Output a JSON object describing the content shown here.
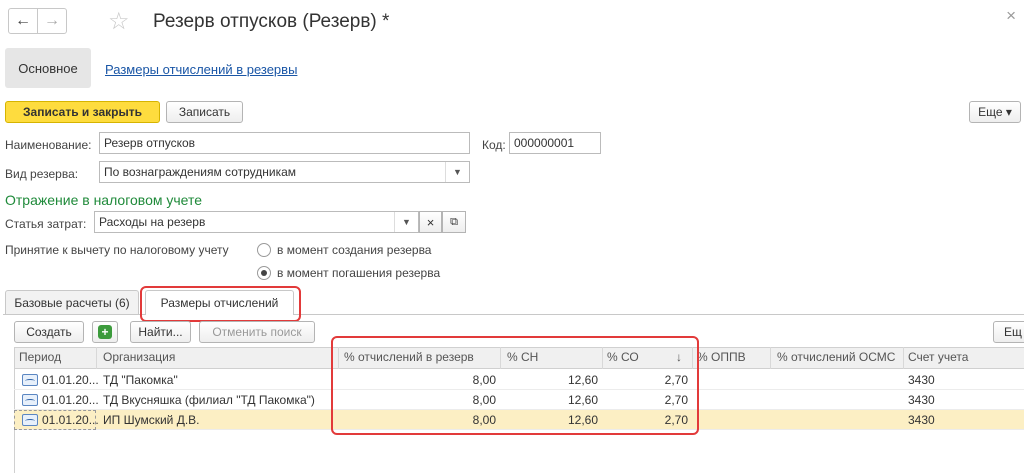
{
  "header": {
    "title": "Резерв отпусков (Резерв) *",
    "back_glyph": "←",
    "forward_glyph": "→",
    "star_glyph": "☆",
    "close_glyph": "×"
  },
  "sections": {
    "main": "Основное",
    "link": "Размеры отчислений в резервы"
  },
  "toolbar": {
    "save_close": "Записать и закрыть",
    "save": "Записать",
    "more": "Еще ▾"
  },
  "form": {
    "name_label": "Наименование:",
    "name_value": "Резерв отпусков",
    "code_label": "Код:",
    "code_value": "000000001",
    "reserve_type_label": "Вид резерва:",
    "reserve_type_value": "По вознаграждениям сотрудникам",
    "tax_section": "Отражение в налоговом учете",
    "expense_label": "Статья затрат:",
    "expense_value": "Расходы на резерв",
    "deduction_label": "Принятие к вычету по налоговому учету",
    "radio_option_1": "в момент создания резерва",
    "radio_option_2": "в момент погашения резерва",
    "selected_option": 2
  },
  "tabs": [
    {
      "label": "Базовые расчеты (6)",
      "active": false
    },
    {
      "label": "Размеры отчислений",
      "active": true
    }
  ],
  "table_toolbar": {
    "create": "Создать",
    "find": "Найти...",
    "cancel_search": "Отменить поиск",
    "more": "Ещ"
  },
  "table": {
    "columns": [
      "Период",
      "Организация",
      "% отчислений в резерв",
      "% СН",
      "% СО",
      "% ОППВ",
      "% отчислений ОСМС",
      "Счет учета"
    ],
    "sort_glyph": "↓",
    "rows": [
      {
        "period": "01.01.20...",
        "org": "ТД \"Пакомка\"",
        "pct_reserve": "8,00",
        "pct_sn": "12,60",
        "pct_so": "2,70",
        "pct_oppv": "",
        "pct_osms": "",
        "account": "3430",
        "selected": false
      },
      {
        "period": "01.01.20...",
        "org": "ТД Вкусняшка (филиал \"ТД Пакомка\")",
        "pct_reserve": "8,00",
        "pct_sn": "12,60",
        "pct_so": "2,70",
        "pct_oppv": "",
        "pct_osms": "",
        "account": "3430",
        "selected": false
      },
      {
        "period": "01.01.20...",
        "org": "ИП Шумский Д.В.",
        "pct_reserve": "8,00",
        "pct_sn": "12,60",
        "pct_so": "2,70",
        "pct_oppv": "",
        "pct_osms": "",
        "account": "3430",
        "selected": true
      }
    ]
  },
  "colors": {
    "primary_button": "#fedc3e",
    "link": "#1a56a6",
    "section_header": "#1f8a3a",
    "highlight_box": "#e23a3a",
    "selected_row": "#fcefc4"
  }
}
